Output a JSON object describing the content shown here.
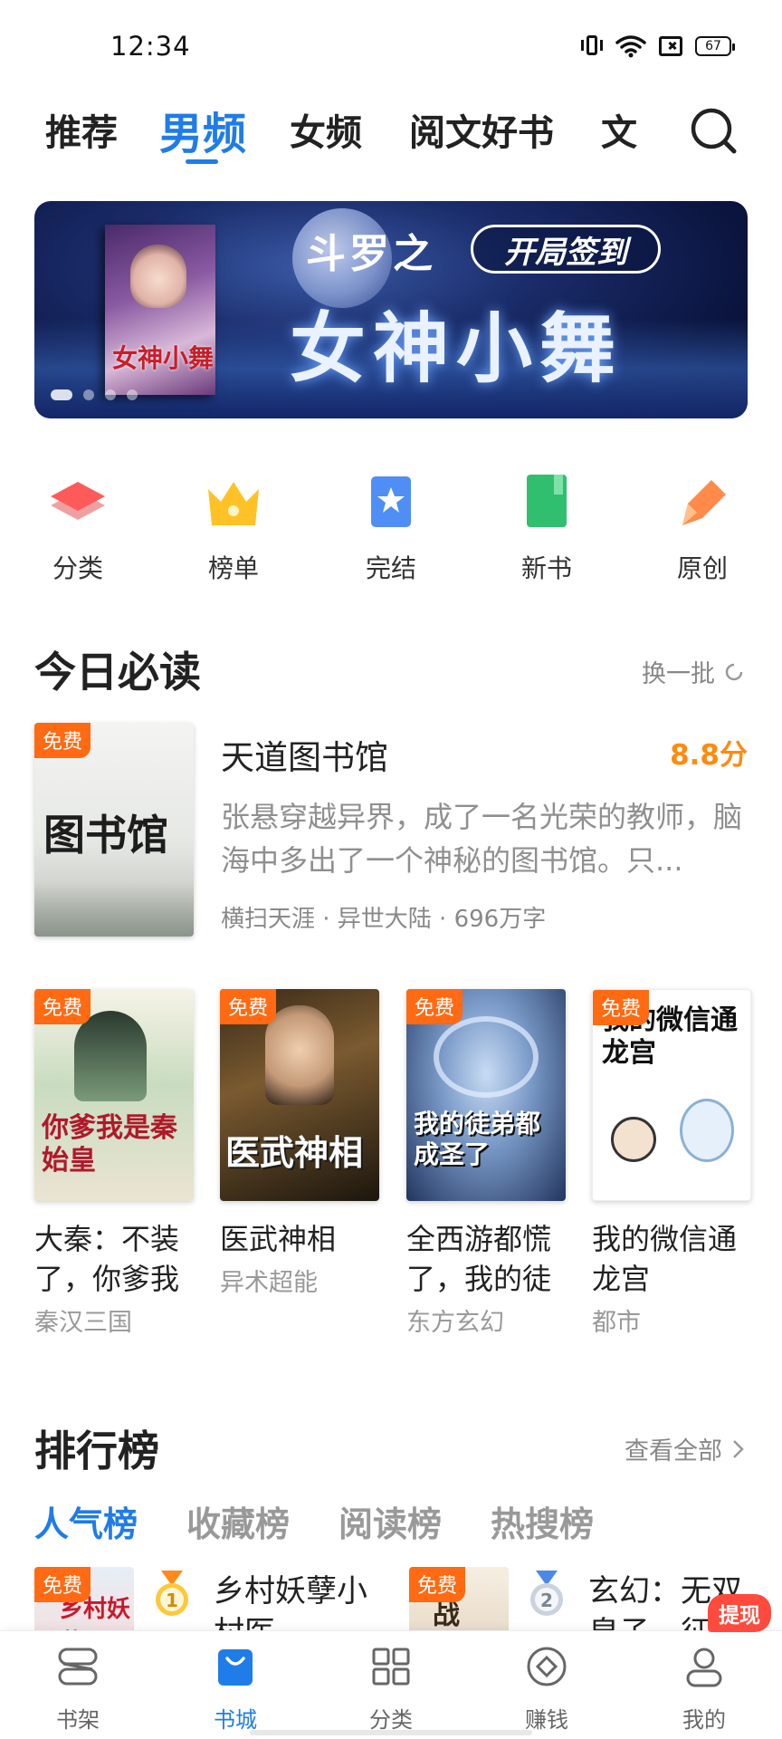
{
  "status_bar": {
    "time": "12:34",
    "battery": "67"
  },
  "top_tabs": {
    "items": [
      "推荐",
      "男频",
      "女频",
      "阅文好书",
      "文"
    ],
    "active": "男频"
  },
  "banner": {
    "line1": "斗罗之",
    "pill": "开局签到",
    "title": "女神小舞",
    "cover_title": "女神小舞",
    "dots": 4,
    "active_dot": 1
  },
  "quick_nav": {
    "items": [
      {
        "label": "分类",
        "icon": "layers-icon"
      },
      {
        "label": "榜单",
        "icon": "crown-icon"
      },
      {
        "label": "完结",
        "icon": "bookmark-star-icon"
      },
      {
        "label": "新书",
        "icon": "green-book-icon"
      },
      {
        "label": "原创",
        "icon": "pen-icon"
      }
    ]
  },
  "today": {
    "title": "今日必读",
    "refresh": "换一批",
    "featured": {
      "badge": "免费",
      "title": "天道图书馆",
      "score": "8.8分",
      "desc": "张悬穿越异界，成了一名光荣的教师，脑海中多出了一个神秘的图书馆。只...",
      "meta": "横扫天涯 · 异世大陆 · 696万字",
      "cover_text": "图书馆"
    },
    "books": [
      {
        "badge": "免费",
        "title": "大秦：不装了，你爹我",
        "genre": "秦汉三国",
        "cover_text": "你爹我是秦始皇"
      },
      {
        "badge": "免费",
        "title": "医武神相",
        "genre": "异术超能",
        "cover_text": "医武神相"
      },
      {
        "badge": "免费",
        "title": "全西游都慌了，我的徒",
        "genre": "东方玄幻",
        "cover_text": "我的徒弟都成圣了"
      },
      {
        "badge": "免费",
        "title": "我的微信通龙宫",
        "genre": "都市",
        "cover_text": "我的微信通龙宫"
      }
    ]
  },
  "ranking": {
    "title": "排行榜",
    "view_all": "查看全部",
    "tabs": [
      "人气榜",
      "收藏榜",
      "阅读榜",
      "热搜榜"
    ],
    "active_tab": "人气榜",
    "rows": [
      {
        "badge": "免费",
        "rank": "1",
        "title": "乡村妖孽小村医",
        "cover_text": "乡村妖孽"
      },
      {
        "badge": "免费",
        "rank": "2",
        "title": "玄幻：无双皇子，征战",
        "cover_text": "战"
      }
    ]
  },
  "bottom_nav": {
    "items": [
      {
        "label": "书架",
        "icon": "bookshelf-icon"
      },
      {
        "label": "书城",
        "icon": "bookstore-icon"
      },
      {
        "label": "分类",
        "icon": "grid-icon"
      },
      {
        "label": "赚钱",
        "icon": "coin-icon"
      },
      {
        "label": "我的",
        "icon": "profile-icon"
      }
    ],
    "active": "书城",
    "withdraw_badge": "提现"
  },
  "colors": {
    "accent": "#1f7ce8",
    "free_badge": "#ff6a12",
    "score": "#ff8a10",
    "withdraw": "#ff4a3e"
  }
}
